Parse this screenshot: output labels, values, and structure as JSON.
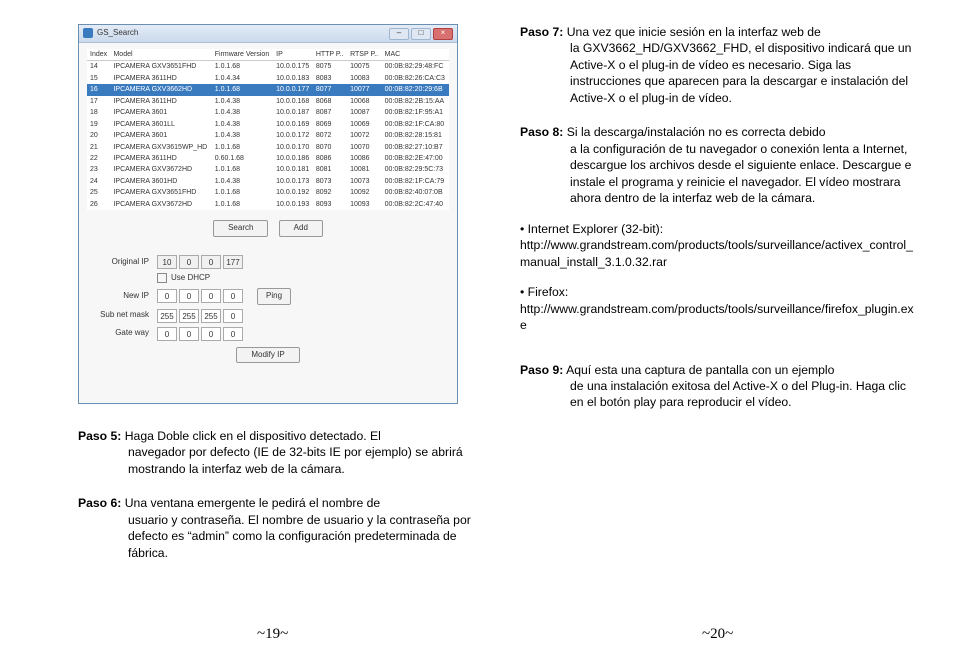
{
  "gs": {
    "title": "GS_Search",
    "headers": [
      "Index",
      "Model",
      "Firmware Version",
      "IP",
      "HTTP P..",
      "RTSP P..",
      "MAC"
    ],
    "rows": [
      [
        "14",
        "IPCAMERA GXV3651FHD",
        "1.0.1.68",
        "10.0.0.175",
        "8075",
        "10075",
        "00:0B:82:29:48:FC"
      ],
      [
        "15",
        "IPCAMERA 3611HD",
        "1.0.4.34",
        "10.0.0.183",
        "8083",
        "10083",
        "00:0B:82:26:CA:C3"
      ],
      [
        "16",
        "IPCAMERA GXV3662HD",
        "1.0.1.68",
        "10.0.0.177",
        "8077",
        "10077",
        "00:0B:82:20:29:6B"
      ],
      [
        "17",
        "IPCAMERA 3611HD",
        "1.0.4.38",
        "10.0.0.168",
        "8068",
        "10068",
        "00:0B:82:2B:15:AA"
      ],
      [
        "18",
        "IPCAMERA 3601",
        "1.0.4.38",
        "10.0.0.187",
        "8087",
        "10087",
        "00:0B:82:1F:95:A1"
      ],
      [
        "19",
        "IPCAMERA 3601LL",
        "1.0.4.38",
        "10.0.0.169",
        "8069",
        "10069",
        "00:0B:82:1F:CA:80"
      ],
      [
        "20",
        "IPCAMERA 3601",
        "1.0.4.38",
        "10.0.0.172",
        "8072",
        "10072",
        "00:0B:82:28:15:81"
      ],
      [
        "21",
        "IPCAMERA GXV3615WP_HD",
        "1.0.1.68",
        "10.0.0.170",
        "8070",
        "10070",
        "00:0B:82:27:10:B7"
      ],
      [
        "22",
        "IPCAMERA 3611HD",
        "0.60.1.68",
        "10.0.0.186",
        "8086",
        "10086",
        "00:0B:82:2E:47:00"
      ],
      [
        "23",
        "IPCAMERA GXV3672HD",
        "1.0.1.68",
        "10.0.0.181",
        "8081",
        "10081",
        "00:0B:82:29:5C:73"
      ],
      [
        "24",
        "IPCAMERA 3601HD",
        "1.0.4.38",
        "10.0.0.173",
        "8073",
        "10073",
        "00:0B:82:1F:CA:79"
      ],
      [
        "25",
        "IPCAMERA GXV3651FHD",
        "1.0.1.68",
        "10.0.0.192",
        "8092",
        "10092",
        "00:0B:82:40:07:0B"
      ],
      [
        "26",
        "IPCAMERA GXV3672HD",
        "1.0.1.68",
        "10.0.0.193",
        "8093",
        "10093",
        "00:0B:82:2C:47:40"
      ]
    ],
    "btn_search": "Search",
    "btn_add": "Add",
    "lbl_original_ip": "Original IP",
    "orig_ip": [
      "10",
      "0",
      "0",
      "177"
    ],
    "lbl_dhcp": "Use DHCP",
    "lbl_new_ip": "New IP",
    "new_ip": [
      "0",
      "0",
      "0",
      "0"
    ],
    "btn_ping": "Ping",
    "lbl_subnet": "Sub net mask",
    "subnet": [
      "255",
      "255",
      "255",
      "0"
    ],
    "lbl_gateway": "Gate way",
    "gateway": [
      "0",
      "0",
      "0",
      "0"
    ],
    "btn_modify": "Modify IP"
  },
  "left": {
    "s5_label": "Paso 5:",
    "s5_a": "Haga Doble click en el dispositivo detectado. El",
    "s5_b": "navegador por defecto (IE de 32-bits IE por ejemplo) se abrirá mostrando la interfaz web de la cámara.",
    "s6_label": "Paso 6:",
    "s6_a": "Una ventana emergente le pedirá el nombre de",
    "s6_b": "usuario y contraseña. El nombre de usuario y la contraseña por defecto es “admin” como la configuración predeterminada de fábrica."
  },
  "right": {
    "s7_label": "Paso 7:",
    "s7_a": "Una vez que inicie sesión en la interfaz web de",
    "s7_b": "la GXV3662_HD/GXV3662_FHD, el dispositivo indicará que un Active-X o el plug-in de vídeo es necesario. Siga las instrucciones que aparecen para la descargar e instalación del Active-X o el plug-in de vídeo.",
    "s8_label": "Paso 8:",
    "s8_a": "Si la descarga/instalación no es correcta debido",
    "s8_b": "a la configuración de tu navegador o conexión lenta a Internet, descargue los archivos desde el siguiente enlace. Descargue e instale el programa y reinicie el navegador. El vídeo mostrara ahora dentro de la interfaz web de la cámara.",
    "ie_title": "• Internet Explorer (32-bit):",
    "ie_link": "http://www.grandstream.com/products/tools/surveillance/activex_control_manual_install_3.1.0.32.rar",
    "ff_title": "• Firefox:",
    "ff_link": "http://www.grandstream.com/products/tools/surveillance/firefox_plugin.exe",
    "s9_label": "Paso 9:",
    "s9_a": "Aquí esta una captura de pantalla con un ejemplo",
    "s9_b": "de una instalación exitosa del Active-X o del Plug-in. Haga clic en el botón play para reproducir el vídeo."
  },
  "pg_left": "~19~",
  "pg_right": "~20~"
}
